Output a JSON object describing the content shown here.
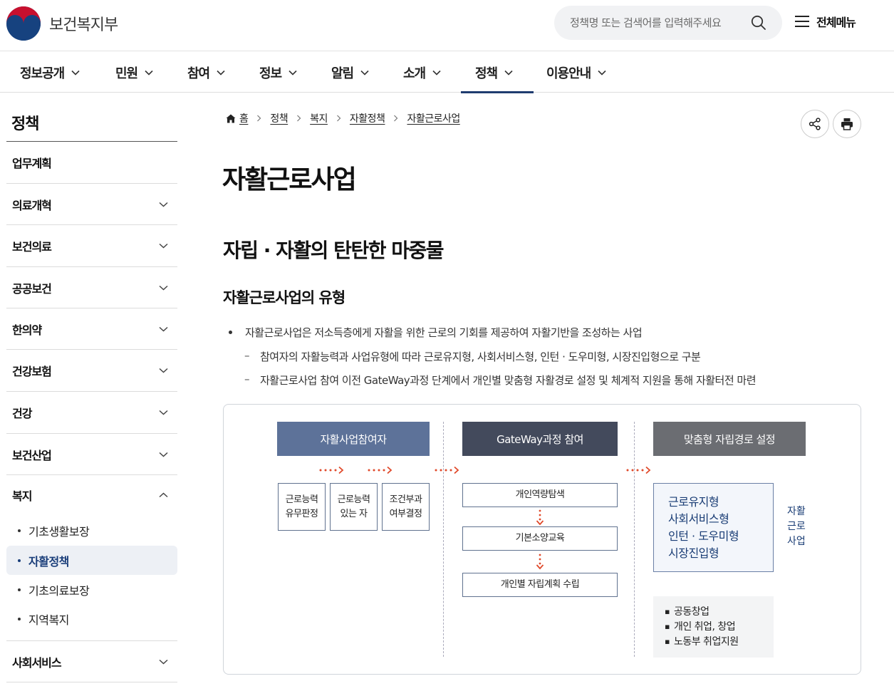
{
  "header": {
    "logo_text": "보건복지부",
    "search_placeholder": "정책명 또는 검색어를 입력해주세요",
    "all_menu_label": "전체메뉴"
  },
  "gnb": {
    "items": [
      {
        "label": "정보공개"
      },
      {
        "label": "민원"
      },
      {
        "label": "참여"
      },
      {
        "label": "정보"
      },
      {
        "label": "알림"
      },
      {
        "label": "소개"
      },
      {
        "label": "정책",
        "active": true
      },
      {
        "label": "이용안내"
      }
    ]
  },
  "sidebar": {
    "title": "정책",
    "items": [
      {
        "label": "업무계획"
      },
      {
        "label": "의료개혁"
      },
      {
        "label": "보건의료"
      },
      {
        "label": "공공보건"
      },
      {
        "label": "한의약"
      },
      {
        "label": "건강보험"
      },
      {
        "label": "건강"
      },
      {
        "label": "보건산업"
      },
      {
        "label": "복지",
        "expanded": true
      },
      {
        "label": "사회서비스"
      }
    ],
    "sub_items": [
      {
        "label": "기초생활보장"
      },
      {
        "label": "자활정책",
        "active": true
      },
      {
        "label": "기초의료보장"
      },
      {
        "label": "지역복지"
      }
    ]
  },
  "breadcrumb": {
    "home": "홈",
    "items": [
      "정책",
      "복지",
      "자활정책",
      "자활근로사업"
    ]
  },
  "content": {
    "page_title": "자활근로사업",
    "heading": "자립 · 자활의 탄탄한 마중물",
    "subheading": "자활근로사업의 유형",
    "bullet": "자활근로사업은 저소득층에게 자활을 위한 근로의 기회를 제공하여 자활기반을 조성하는 사업",
    "sub_bullets": [
      "참여자의 자활능력과 사업유형에 따라 근로유지형, 사회서비스형, 인턴 · 도우미형, 시장진입형으로 구분",
      "자활근로사업 참여 이전 GateWay과정 단계에서 개인별 맞춤형 자활경로 설정 및 체계적 지원을 통해 자활터전 마련"
    ]
  },
  "diagram": {
    "headers": [
      "자활사업참여자",
      "GateWay과정 참여",
      "맞춤형 자립경로 설정"
    ],
    "header_colors": [
      "#5d7299",
      "#434a5c",
      "#6b6d72"
    ],
    "steps1": [
      [
        "근로능력",
        "유무판정"
      ],
      [
        "근로능력",
        "있는 자"
      ],
      [
        "조건부과",
        "여부결정"
      ]
    ],
    "steps2": [
      "개인역량탐색",
      "기본소양교육",
      "개인별 자립계획 수립"
    ],
    "types": [
      "근로유지형",
      "사회서비스형",
      "인턴 · 도우미형",
      "시장진입형"
    ],
    "side_label": [
      "자활",
      "근로",
      "사업"
    ],
    "notes": [
      "공동창업",
      "개인 취업, 창업",
      "노동부 취업지원"
    ],
    "arrow_color": "#e0492a"
  }
}
